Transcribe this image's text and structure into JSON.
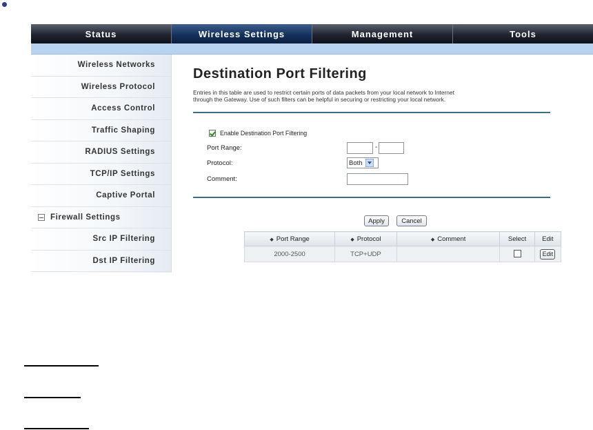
{
  "nav": {
    "tabs": [
      {
        "label": "Status"
      },
      {
        "label": "Wireless Settings"
      },
      {
        "label": "Management"
      },
      {
        "label": "Tools"
      }
    ]
  },
  "sidebar": {
    "items": [
      {
        "label": "Wireless Networks"
      },
      {
        "label": "Wireless Protocol"
      },
      {
        "label": "Access Control"
      },
      {
        "label": "Traffic Shaping"
      },
      {
        "label": "RADIUS Settings"
      },
      {
        "label": "TCP/IP Settings"
      },
      {
        "label": "Captive Portal"
      },
      {
        "label": "Firewall Settings"
      },
      {
        "label": "Src IP Filtering"
      },
      {
        "label": "Dst IP Filtering"
      }
    ]
  },
  "main": {
    "title": "Destination Port Filtering",
    "description_line1": "Entries in this table are used to restrict certain ports of data packets from your local network to Internet",
    "description_line2": "through the Gateway. Use of such filters can be helpful in securing or restricting your local network."
  },
  "form": {
    "enable_label": "Enable Destination Port Filtering",
    "port_range_label": "Port Range:",
    "range_separator": "-",
    "protocol_label": "Protocol:",
    "protocol_value": "Both",
    "comment_label": "Comment:",
    "apply_label": "Apply",
    "cancel_label": "Cancel"
  },
  "table": {
    "columns": [
      "Port Range",
      "Protocol",
      "Comment",
      "Select",
      "Edit"
    ],
    "rows": [
      {
        "port_range": "2000-2500",
        "protocol": "TCP+UDP",
        "comment": "",
        "edit_label": "Edit"
      }
    ]
  }
}
